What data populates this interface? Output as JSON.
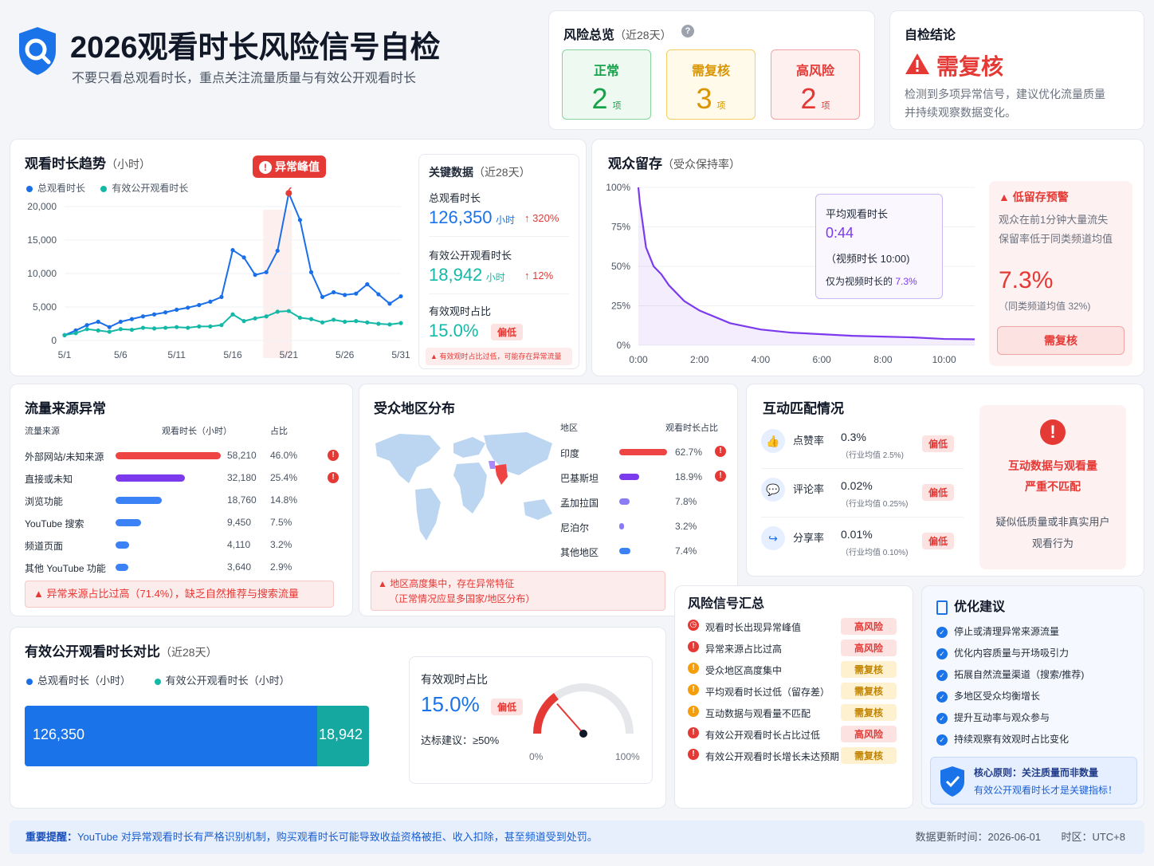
{
  "header": {
    "title": "2026观看时长风险信号自检",
    "subtitle": "不要只看总观看时长，重点关注流量质量与有效公开观看时长"
  },
  "overview": {
    "title": "风险总览",
    "period": "（近28天）",
    "help_icon": "question-circle-icon",
    "boxes": [
      {
        "label": "正常",
        "count": "2",
        "unit": "项",
        "color": "#16a34a"
      },
      {
        "label": "需复核",
        "count": "3",
        "unit": "项",
        "color": "#d99400"
      },
      {
        "label": "高风险",
        "count": "2",
        "unit": "项",
        "color": "#e53935"
      }
    ]
  },
  "conclusion": {
    "title": "自检结论",
    "verdict": "需复核",
    "text1": "检测到多项异常信号，建议优化流量质量",
    "text2": "并持续观察数据变化。"
  },
  "trend": {
    "title": "观看时长趋势",
    "unit": "（小时）",
    "legend_total": "总观看时长",
    "legend_valid": "有效公开观看时长",
    "peak_label": "异常峰值"
  },
  "chart_data": [
    {
      "type": "line",
      "title": "观看时长趋势（小时）",
      "x": [
        "5/1",
        "5/2",
        "5/3",
        "5/4",
        "5/5",
        "5/6",
        "5/7",
        "5/8",
        "5/9",
        "5/10",
        "5/11",
        "5/12",
        "5/13",
        "5/14",
        "5/15",
        "5/16",
        "5/17",
        "5/18",
        "5/19",
        "5/20",
        "5/21",
        "5/22",
        "5/23",
        "5/24",
        "5/25",
        "5/26",
        "5/27",
        "5/28",
        "5/29",
        "5/30",
        "5/31"
      ],
      "xticks": [
        "5/1",
        "5/6",
        "5/11",
        "5/16",
        "5/21",
        "5/26",
        "5/31"
      ],
      "yticks": [
        "0",
        "5,000",
        "10,000",
        "15,000",
        "20,000"
      ],
      "ylim": [
        0,
        20000
      ],
      "series": [
        {
          "name": "总观看时长",
          "color": "#1a6fe8",
          "values": [
            800,
            1500,
            2300,
            2800,
            2000,
            2800,
            3200,
            3600,
            3900,
            4200,
            4600,
            4900,
            5300,
            5800,
            6500,
            13500,
            12400,
            9800,
            10200,
            13400,
            22000,
            18000,
            10200,
            6500,
            7200,
            6800,
            7000,
            8400,
            6900,
            5500,
            6600
          ]
        },
        {
          "name": "有效公开观看时长",
          "color": "#14b8a6",
          "values": [
            800,
            1100,
            1700,
            1500,
            1300,
            1700,
            1600,
            1900,
            1800,
            1900,
            2000,
            1900,
            2100,
            2100,
            2300,
            3900,
            2900,
            3300,
            3600,
            4300,
            4400,
            3400,
            3200,
            2700,
            3100,
            2800,
            2900,
            2700,
            2500,
            2400,
            2600
          ]
        }
      ]
    },
    {
      "type": "line",
      "title": "观众留存（受众保持率）",
      "x": [
        "0:00",
        "2:00",
        "4:00",
        "6:00",
        "8:00",
        "10:00"
      ],
      "yticks": [
        "0%",
        "25%",
        "50%",
        "75%",
        "100%"
      ],
      "ylim": [
        0,
        100
      ],
      "series": [
        {
          "name": "受众保持率",
          "color": "#7c3aed",
          "values": [
            [
              0,
              100
            ],
            [
              0.05,
              90
            ],
            [
              0.25,
              62
            ],
            [
              0.5,
              50
            ],
            [
              0.75,
              45
            ],
            [
              1,
              38
            ],
            [
              1.5,
              28
            ],
            [
              2,
              22
            ],
            [
              3,
              14
            ],
            [
              4,
              10
            ],
            [
              5,
              8
            ],
            [
              6,
              7
            ],
            [
              7,
              6
            ],
            [
              8,
              5.5
            ],
            [
              9,
              5
            ],
            [
              10,
              4
            ],
            [
              11,
              3.8
            ]
          ]
        }
      ]
    },
    {
      "type": "bar",
      "title": "有效公开观看时长对比（近28天）",
      "categories": [
        "总观看时长（小时）",
        "有效公开观看时长（小时）"
      ],
      "values": [
        126350,
        18942
      ]
    }
  ],
  "key_data": {
    "title": "关键数据",
    "period": "（近28天）",
    "total_label": "总观看时长",
    "total_value": "126,350",
    "total_unit": "小时",
    "total_change": "320%",
    "valid_label": "有效公开观看时长",
    "valid_value": "18,942",
    "valid_unit": "小时",
    "valid_change": "12%",
    "ratio_label": "有效观时占比",
    "ratio_value": "15.0%",
    "ratio_badge": "偏低",
    "warn": "有效观时占比过低，可能存在异常流量"
  },
  "retention": {
    "title": "观众留存",
    "subtitle": "（受众保持率）",
    "avg_label": "平均观看时长",
    "avg_value": "0:44",
    "avg_video": "（视频时长 10:00)",
    "avg_pct_text": "仅为视频时长的",
    "avg_pct": "7.3%",
    "alert_title": "低留存预警",
    "alert_l1": "观众在前1分钟大量流失",
    "alert_l2": "保留率低于同类频道均值",
    "alert_value": "7.3%",
    "alert_avg": "（同类频道均值 32%)",
    "alert_btn": "需复核"
  },
  "traffic": {
    "title": "流量来源异常",
    "col_source": "流量来源",
    "col_hours": "观看时长（小时）",
    "col_pct": "占比",
    "rows": [
      {
        "name": "外部网站/未知来源",
        "hours": "58,210",
        "pct": "46.0%",
        "frac": 1.0,
        "color": "#ef4444",
        "alert": true
      },
      {
        "name": "直接或未知",
        "hours": "32,180",
        "pct": "25.4%",
        "frac": 0.66,
        "color": "#7c3aed",
        "alert": true
      },
      {
        "name": "浏览功能",
        "hours": "18,760",
        "pct": "14.8%",
        "frac": 0.44,
        "color": "#3b82f6",
        "alert": false
      },
      {
        "name": "YouTube 搜索",
        "hours": "9,450",
        "pct": "7.5%",
        "frac": 0.24,
        "color": "#3b82f6",
        "alert": false
      },
      {
        "name": "频道页面",
        "hours": "4,110",
        "pct": "3.2%",
        "frac": 0.13,
        "color": "#3b82f6",
        "alert": false
      },
      {
        "name": "其他 YouTube 功能",
        "hours": "3,640",
        "pct": "2.9%",
        "frac": 0.12,
        "color": "#3b82f6",
        "alert": false
      }
    ],
    "warn": "异常来源占比过高（71.4%），缺乏自然推荐与搜索流量"
  },
  "geo": {
    "title": "受众地区分布",
    "col_region": "地区",
    "col_pct": "观看时长占比",
    "rows": [
      {
        "name": "印度",
        "pct": "62.7%",
        "frac": 1.0,
        "color": "#ef4444",
        "alert": true
      },
      {
        "name": "巴基斯坦",
        "pct": "18.9%",
        "frac": 0.42,
        "color": "#7c3aed",
        "alert": true
      },
      {
        "name": "孟加拉国",
        "pct": "7.8%",
        "frac": 0.22,
        "color": "#8b7cf6",
        "alert": false
      },
      {
        "name": "尼泊尔",
        "pct": "3.2%",
        "frac": 0.1,
        "color": "#8b7cf6",
        "alert": false
      },
      {
        "name": "其他地区",
        "pct": "7.4%",
        "frac": 0.24,
        "color": "#3b82f6",
        "alert": false
      }
    ],
    "warn1": "地区高度集中，存在异常特征",
    "warn2": "（正常情况应显多国家/地区分布）"
  },
  "engagement": {
    "title": "互动匹配情况",
    "rows": [
      {
        "label": "点赞率",
        "value": "0.3%",
        "avg": "（行业均值 2.5%)",
        "badge": "偏低",
        "icon": "thumbs-up-icon"
      },
      {
        "label": "评论率",
        "value": "0.02%",
        "avg": "（行业均值 0.25%)",
        "badge": "偏低",
        "icon": "comment-icon"
      },
      {
        "label": "分享率",
        "value": "0.01%",
        "avg": "（行业均值 0.10%)",
        "badge": "偏低",
        "icon": "share-icon"
      }
    ],
    "alert_t1": "互动数据与观看量",
    "alert_t2": "严重不匹配",
    "alert_d1": "疑似低质量或非真实用户",
    "alert_d2": "观看行为"
  },
  "compare": {
    "title": "有效公开观看时长对比",
    "period": "（近28天）",
    "legend_total": "总观看时长（小时）",
    "legend_valid": "有效公开观看时长（小时）",
    "total_value": "126,350",
    "valid_value": "18,942",
    "ratio_label": "有效观时占比",
    "ratio_value": "15.0%",
    "ratio_badge": "偏低",
    "target": "达标建议：≥50%",
    "gauge_min": "0%",
    "gauge_max": "100%",
    "gauge_frac": 0.15
  },
  "signals": {
    "title": "风险信号汇总",
    "rows": [
      {
        "text": "观看时长出现异常峰值",
        "level": "高风险",
        "type": "red",
        "icon": "clock-icon"
      },
      {
        "text": "异常来源占比过高",
        "level": "高风险",
        "type": "red",
        "icon": "alert-icon"
      },
      {
        "text": "受众地区高度集中",
        "level": "需复核",
        "type": "amber",
        "icon": "alert-icon"
      },
      {
        "text": "平均观看时长过低（留存差）",
        "level": "需复核",
        "type": "amber",
        "icon": "alert-icon"
      },
      {
        "text": "互动数据与观看量不匹配",
        "level": "需复核",
        "type": "amber",
        "icon": "alert-icon"
      },
      {
        "text": "有效公开观看时长占比过低",
        "level": "高风险",
        "type": "red",
        "icon": "alert-icon"
      },
      {
        "text": "有效公开观看时长增长未达预期",
        "level": "需复核",
        "type": "red",
        "icon": "alert-icon"
      }
    ]
  },
  "advice": {
    "title": "优化建议",
    "items": [
      "停止或清理异常来源流量",
      "优化内容质量与开场吸引力",
      "拓展自然流量渠道（搜索/推荐)",
      "多地区受众均衡增长",
      "提升互动率与观众参与",
      "持续观察有效观时占比变化"
    ],
    "core1": "核心原则：关注质量而非数量",
    "core2": "有效公开观看时长才是关键指标！"
  },
  "footer": {
    "label": "重要提醒：",
    "text": "YouTube 对异常观看时长有严格识别机制，购买观看时长可能导致收益资格被拒、收入扣除，甚至频道受到处罚。",
    "updated": "数据更新时间：2026-06-01",
    "tz": "时区：UTC+8"
  }
}
